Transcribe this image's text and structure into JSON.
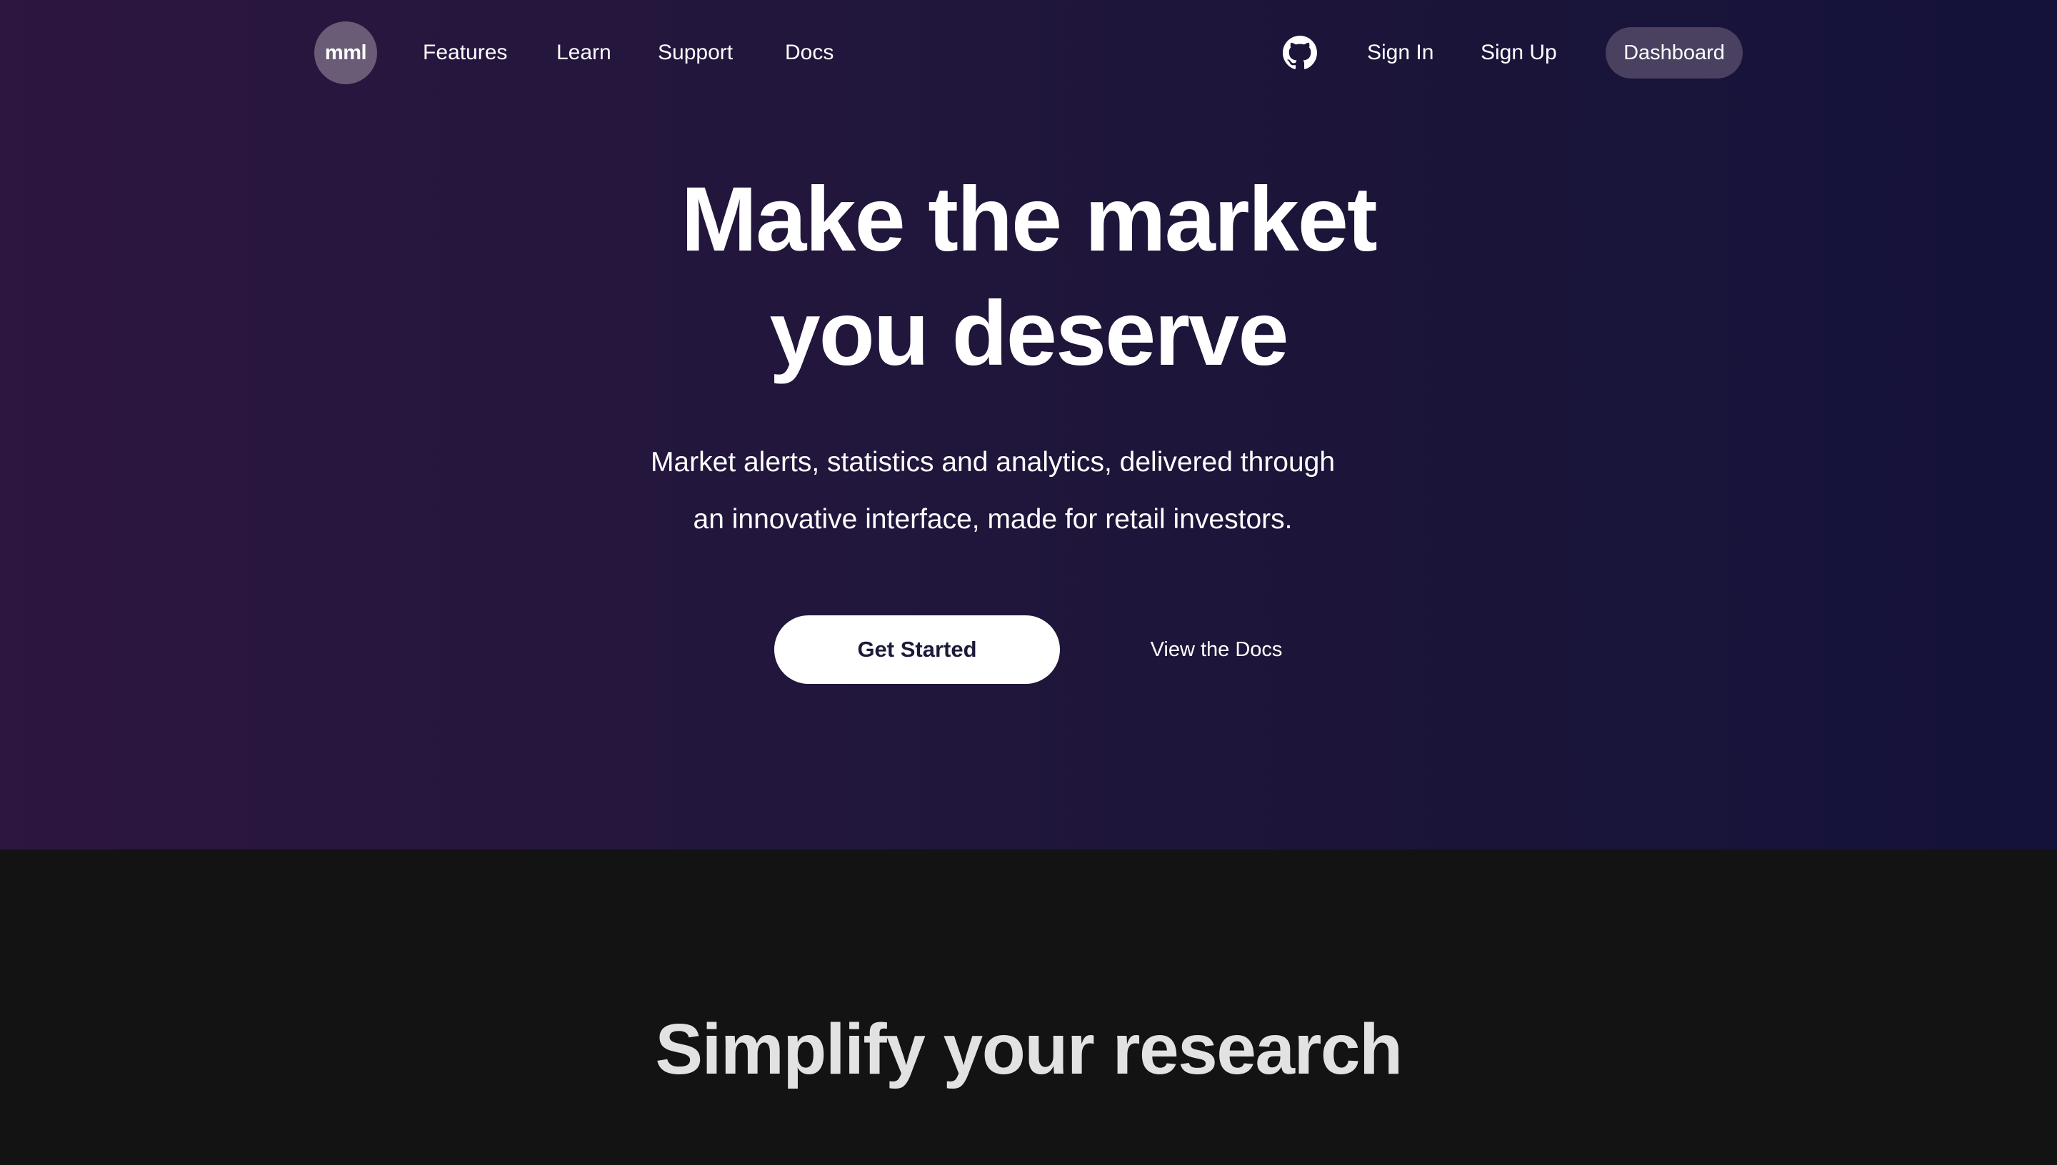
{
  "nav": {
    "logo": "mml",
    "links": [
      "Features",
      "Learn",
      "Support",
      "Docs"
    ],
    "github_icon": "github-icon",
    "sign_in": "Sign In",
    "sign_up": "Sign Up",
    "dashboard": "Dashboard"
  },
  "hero": {
    "title_lines": [
      "Make the market",
      "you deserve"
    ],
    "subtitle_lines": [
      "Market alerts, statistics and analytics, delivered through",
      "an innovative interface, made for retail investors."
    ],
    "primary_cta": "Get Started",
    "secondary_cta": "View the Docs"
  },
  "section_two": {
    "title": "Simplify your research"
  },
  "colors": {
    "hero_gradient_start": "#2d1640",
    "hero_gradient_end": "#14123a",
    "dark_section_bg": "#131313",
    "dashboard_button_bg": "#4a4060",
    "logo_bg": "#6a5c76",
    "primary_cta_bg": "#ffffff",
    "primary_cta_text": "#1c1a3a"
  }
}
